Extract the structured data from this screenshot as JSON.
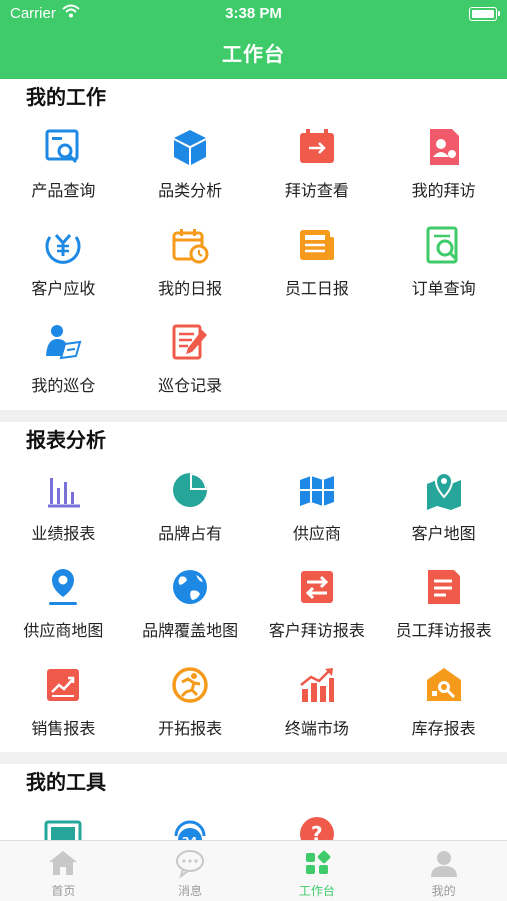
{
  "status_bar": {
    "carrier": "Carrier",
    "time": "3:38 PM"
  },
  "header": {
    "title": "工作台"
  },
  "sections": [
    {
      "title": "我的工作",
      "items": [
        {
          "label": "产品查询",
          "icon": "product-search-icon",
          "color": "#1e88e5"
        },
        {
          "label": "品类分析",
          "icon": "cube-icon",
          "color": "#1e88e5"
        },
        {
          "label": "拜访查看",
          "icon": "calendar-arrow-icon",
          "color": "#f05a4a"
        },
        {
          "label": "我的拜访",
          "icon": "visit-profile-icon",
          "color": "#f05a6a"
        },
        {
          "label": "客户应收",
          "icon": "yen-icon",
          "color": "#1e88e5"
        },
        {
          "label": "我的日报",
          "icon": "calendar-clock-icon",
          "color": "#f59a1b"
        },
        {
          "label": "员工日报",
          "icon": "newspaper-icon",
          "color": "#f59a1b"
        },
        {
          "label": "订单查询",
          "icon": "order-search-icon",
          "color": "#3fcb6a"
        },
        {
          "label": "我的巡仓",
          "icon": "person-writing-icon",
          "color": "#1e88e5"
        },
        {
          "label": "巡仓记录",
          "icon": "notes-pen-icon",
          "color": "#f05a4a"
        }
      ]
    },
    {
      "title": "报表分析",
      "items": [
        {
          "label": "业绩报表",
          "icon": "bar-chart-icon",
          "color": "#7b6fd8"
        },
        {
          "label": "品牌占有",
          "icon": "pie-chart-icon",
          "color": "#26a69a"
        },
        {
          "label": "供应商",
          "icon": "folded-map-icon",
          "color": "#1e88e5"
        },
        {
          "label": "客户地图",
          "icon": "map-pin-icon",
          "color": "#26a69a"
        },
        {
          "label": "供应商地图",
          "icon": "location-pin-icon",
          "color": "#1e88e5"
        },
        {
          "label": "品牌覆盖地图",
          "icon": "globe-icon",
          "color": "#1e88e5"
        },
        {
          "label": "客户拜访报表",
          "icon": "swap-icon",
          "color": "#f05a4a"
        },
        {
          "label": "员工拜访报表",
          "icon": "document-icon",
          "color": "#f05a4a"
        },
        {
          "label": "销售报表",
          "icon": "trend-chart-icon",
          "color": "#f05a4a"
        },
        {
          "label": "开拓报表",
          "icon": "runner-icon",
          "color": "#f59a1b"
        },
        {
          "label": "终端市场",
          "icon": "growth-bars-icon",
          "color": "#f05a4a"
        },
        {
          "label": "库存报表",
          "icon": "warehouse-search-icon",
          "color": "#f59a1b"
        }
      ]
    },
    {
      "title": "我的工具",
      "items": [
        {
          "label": "",
          "icon": "monitor-icon",
          "color": "#26a69a"
        },
        {
          "label": "",
          "icon": "service-24h-icon",
          "color": "#1e88e5"
        },
        {
          "label": "",
          "icon": "help-icon",
          "color": "#f05a4a"
        }
      ]
    }
  ],
  "tabbar": [
    {
      "label": "首页",
      "icon": "home-icon",
      "active": false
    },
    {
      "label": "消息",
      "icon": "chat-icon",
      "active": false
    },
    {
      "label": "工作台",
      "icon": "workbench-icon",
      "active": true
    },
    {
      "label": "我的",
      "icon": "user-icon",
      "active": false
    }
  ],
  "colors": {
    "brand": "#3fcb6a",
    "tab_inactive": "#9a9a9a"
  }
}
